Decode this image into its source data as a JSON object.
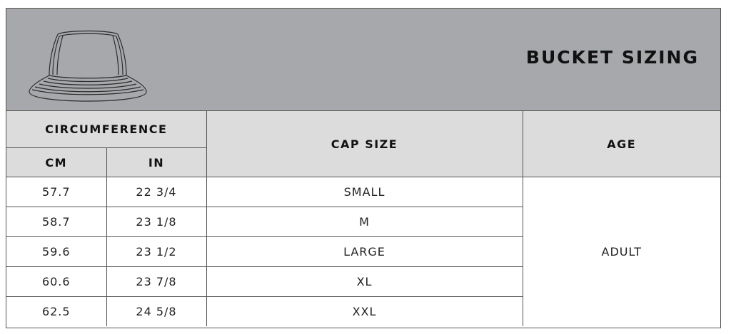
{
  "banner": {
    "title": "BUCKET SIZING",
    "illustration_icon": "bucket-hat-outline-icon",
    "background_color": "#a7a8ab"
  },
  "table": {
    "headers": {
      "circumference": "CIRCUMFERENCE",
      "cm": "CM",
      "in": "IN",
      "cap_size": "CAP SIZE",
      "age": "AGE"
    },
    "header_background": "#dcdcdc",
    "rows": [
      {
        "cm": "57.7",
        "in": "22 3/4",
        "cap_size": "SMALL"
      },
      {
        "cm": "58.7",
        "in": "23 1/8",
        "cap_size": "M"
      },
      {
        "cm": "59.6",
        "in": "23 1/2",
        "cap_size": "LARGE"
      },
      {
        "cm": "60.6",
        "in": "23 7/8",
        "cap_size": "XL"
      },
      {
        "cm": "62.5",
        "in": "24 5/8",
        "cap_size": "XXL"
      }
    ],
    "age_value": "ADULT"
  }
}
